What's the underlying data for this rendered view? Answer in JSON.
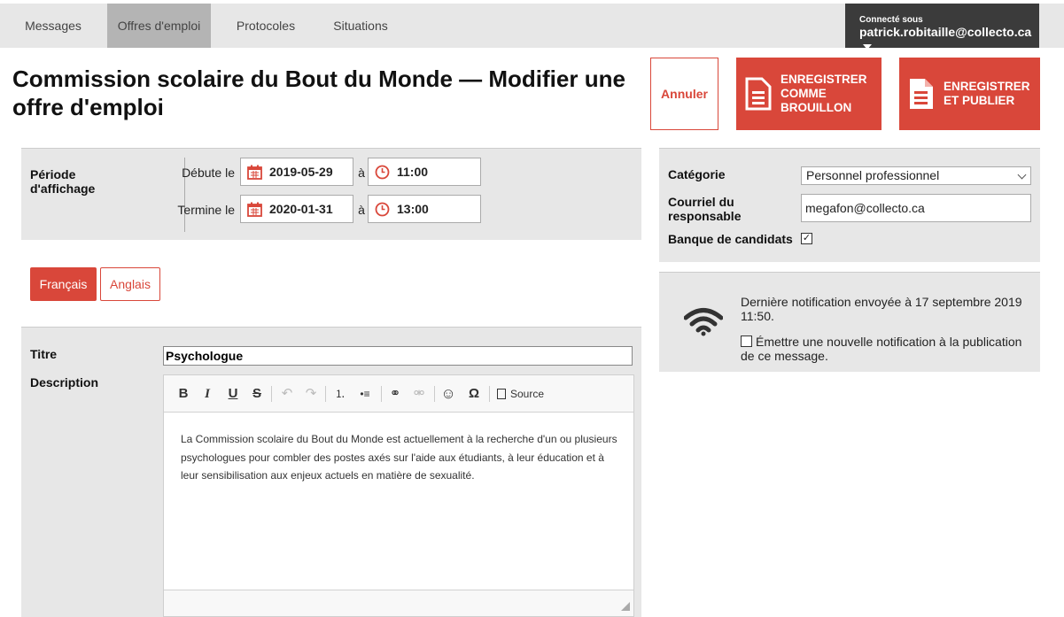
{
  "nav": {
    "items": [
      "Messages",
      "Offres d'emploi",
      "Protocoles",
      "Situations"
    ],
    "active": "Offres d'emploi",
    "user_label": "Connecté sous",
    "user_name": "patrick.robitaille@collecto.ca"
  },
  "header": {
    "title": "Commission scolaire du Bout du Monde — Modifier une offre d'emploi",
    "cancel_label": "Annuler",
    "draft_label": "ENREGISTRER COMME BROUILLON",
    "publish_label": "ENREGISTRER ET PUBLIER"
  },
  "period": {
    "label": "Période d'affichage",
    "start_label": "Débute le",
    "start_date": "2019-05-29",
    "start_time": "11:00",
    "end_label": "Termine le",
    "end_date": "2020-01-31",
    "end_time": "13:00",
    "at": "à"
  },
  "language_tabs": {
    "french": "Français",
    "english": "Anglais",
    "active": "Français"
  },
  "form": {
    "title_label": "Titre",
    "title_value": "Psychologue",
    "description_label": "Description",
    "description_text": "La Commission scolaire du Bout du Monde est actuellement à la recherche d'un ou plusieurs psychologues pour combler des postes axés sur l'aide aux étudiants, à leur éducation et à leur sensibilisation aux enjeux actuels en matière de sexualité."
  },
  "editor_toolbar": {
    "bold": "B",
    "italic": "I",
    "underline": "U",
    "strike": "S",
    "undo": "↶",
    "redo": "↷",
    "ordered_list": "⒈",
    "bullet_list": "•≡",
    "link": "⚭",
    "unlink": "⚮",
    "emoji": "☺",
    "special_char": "Ω",
    "source": "Source"
  },
  "side": {
    "category_label": "Catégorie",
    "category_value": "Personnel professionnel",
    "email_label": "Courriel du responsable",
    "email_value": "megafon@collecto.ca",
    "candidates_label": "Banque de candidats",
    "candidates_checked": true
  },
  "notification": {
    "icon": "wifi-icon",
    "last_sent": "Dernière notification envoyée à 17 septembre 2019 11:50.",
    "emit_label": "Émettre une nouvelle notification à la publication de ce message.",
    "emit_checked": false
  },
  "colors": {
    "accent": "#d9473a",
    "panel": "#e7e7e7",
    "user_bar": "#3b3b3b"
  }
}
